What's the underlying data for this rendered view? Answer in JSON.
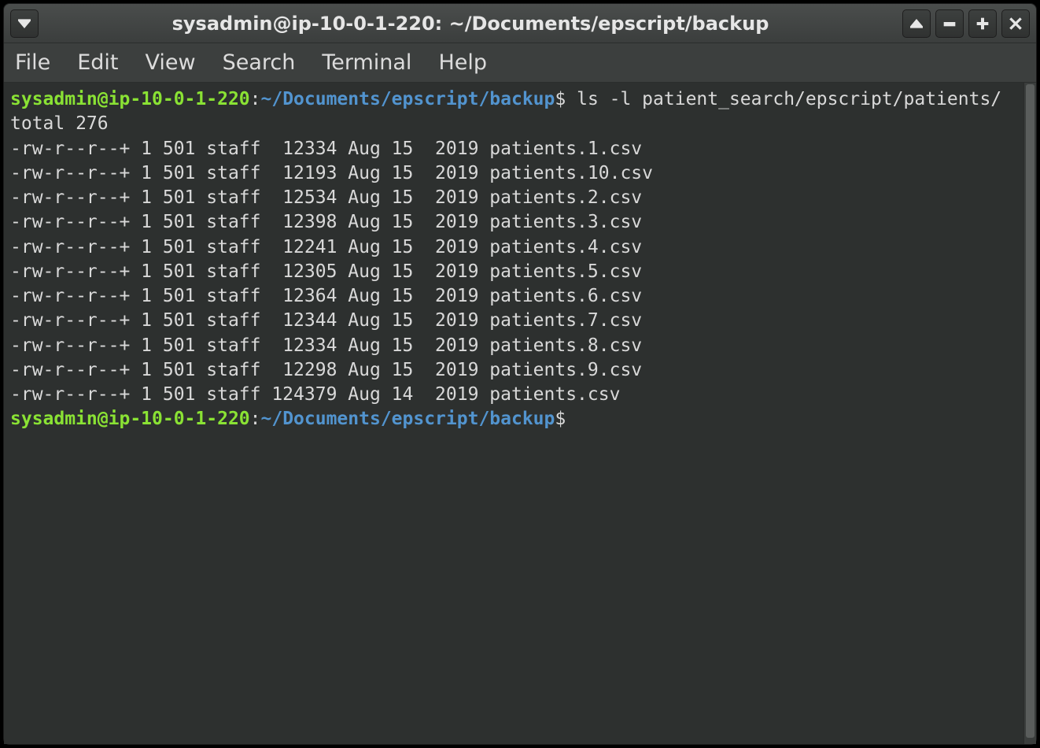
{
  "window": {
    "title": "sysadmin@ip-10-0-1-220: ~/Documents/epscript/backup"
  },
  "menubar": {
    "items": [
      "File",
      "Edit",
      "View",
      "Search",
      "Terminal",
      "Help"
    ]
  },
  "prompt": {
    "user_host": "sysadmin@ip-10-0-1-220",
    "colon": ":",
    "path": "~/Documents/epscript/backup",
    "symbol": "$"
  },
  "command": "ls -l patient_search/epscript/patients/",
  "listing": {
    "total_line": "total 276",
    "rows": [
      {
        "perm": "-rw-r--r--+",
        "links": "1",
        "owner": "501",
        "group": "staff",
        "size": "12334",
        "month": "Aug",
        "day": "15",
        "year": "2019",
        "name": "patients.1.csv"
      },
      {
        "perm": "-rw-r--r--+",
        "links": "1",
        "owner": "501",
        "group": "staff",
        "size": "12193",
        "month": "Aug",
        "day": "15",
        "year": "2019",
        "name": "patients.10.csv"
      },
      {
        "perm": "-rw-r--r--+",
        "links": "1",
        "owner": "501",
        "group": "staff",
        "size": "12534",
        "month": "Aug",
        "day": "15",
        "year": "2019",
        "name": "patients.2.csv"
      },
      {
        "perm": "-rw-r--r--+",
        "links": "1",
        "owner": "501",
        "group": "staff",
        "size": "12398",
        "month": "Aug",
        "day": "15",
        "year": "2019",
        "name": "patients.3.csv"
      },
      {
        "perm": "-rw-r--r--+",
        "links": "1",
        "owner": "501",
        "group": "staff",
        "size": "12241",
        "month": "Aug",
        "day": "15",
        "year": "2019",
        "name": "patients.4.csv"
      },
      {
        "perm": "-rw-r--r--+",
        "links": "1",
        "owner": "501",
        "group": "staff",
        "size": "12305",
        "month": "Aug",
        "day": "15",
        "year": "2019",
        "name": "patients.5.csv"
      },
      {
        "perm": "-rw-r--r--+",
        "links": "1",
        "owner": "501",
        "group": "staff",
        "size": "12364",
        "month": "Aug",
        "day": "15",
        "year": "2019",
        "name": "patients.6.csv"
      },
      {
        "perm": "-rw-r--r--+",
        "links": "1",
        "owner": "501",
        "group": "staff",
        "size": "12344",
        "month": "Aug",
        "day": "15",
        "year": "2019",
        "name": "patients.7.csv"
      },
      {
        "perm": "-rw-r--r--+",
        "links": "1",
        "owner": "501",
        "group": "staff",
        "size": "12334",
        "month": "Aug",
        "day": "15",
        "year": "2019",
        "name": "patients.8.csv"
      },
      {
        "perm": "-rw-r--r--+",
        "links": "1",
        "owner": "501",
        "group": "staff",
        "size": "12298",
        "month": "Aug",
        "day": "15",
        "year": "2019",
        "name": "patients.9.csv"
      },
      {
        "perm": "-rw-r--r--+",
        "links": "1",
        "owner": "501",
        "group": "staff",
        "size": "124379",
        "month": "Aug",
        "day": "14",
        "year": "2019",
        "name": "patients.csv"
      }
    ]
  }
}
